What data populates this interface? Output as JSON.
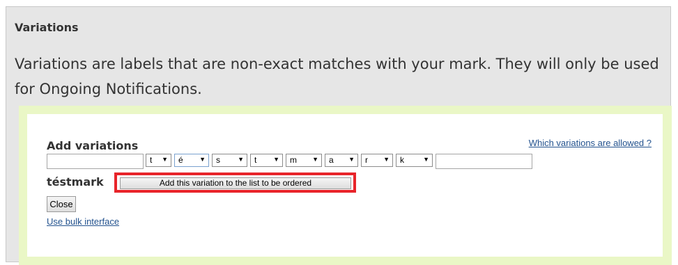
{
  "section": {
    "title": "Variations",
    "description": "Variations are labels that are non-exact matches with your mark. They will only be used for Ongoing Notifications."
  },
  "editor": {
    "heading": "Add variations",
    "help_link": "Which variations are allowed ?",
    "prefix_value": "",
    "suffix_value": "",
    "characters": [
      {
        "value": "t"
      },
      {
        "value": "é"
      },
      {
        "value": "s"
      },
      {
        "value": "t"
      },
      {
        "value": "m"
      },
      {
        "value": "a"
      },
      {
        "value": "r"
      },
      {
        "value": "k"
      }
    ],
    "preview": "téstmark",
    "add_button": "Add this variation to the list to be ordered",
    "close_button": "Close",
    "bulk_link": "Use bulk interface"
  },
  "colors": {
    "highlight": "#e8242a",
    "link": "#24538f",
    "panel_background": "#e6e6e6",
    "inner_border": "#eaf7c6"
  }
}
